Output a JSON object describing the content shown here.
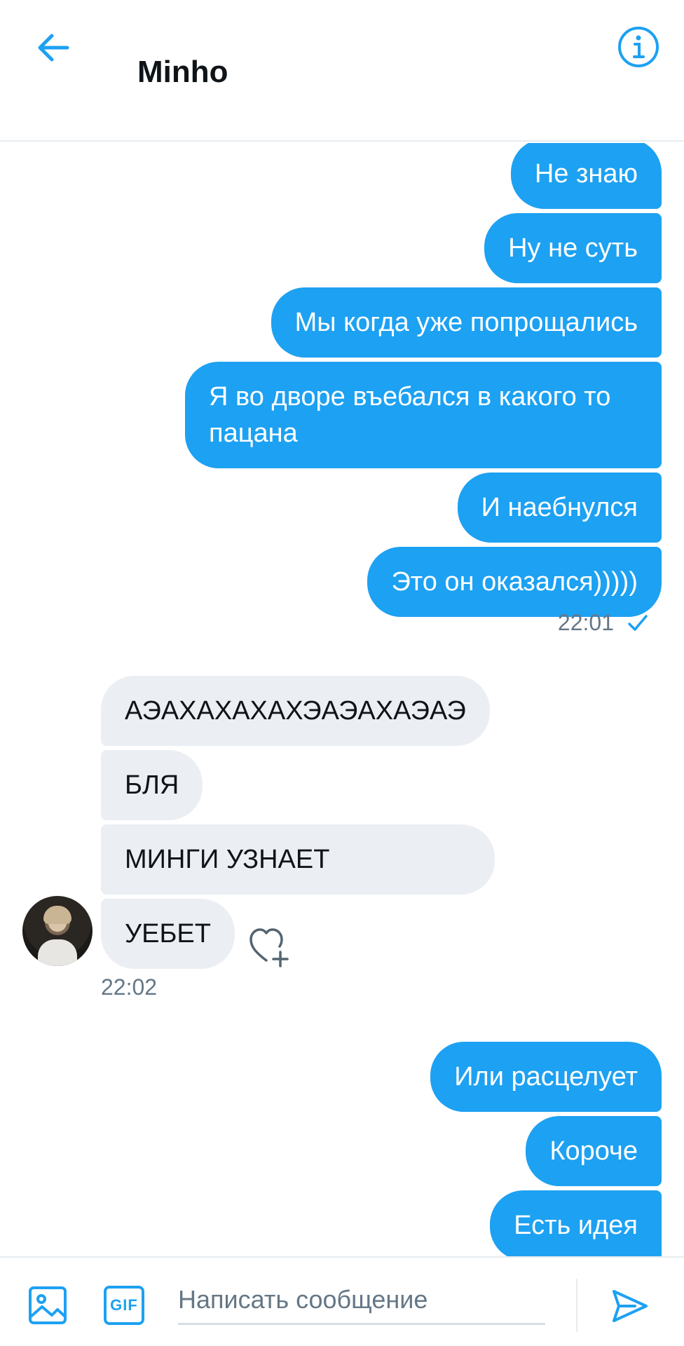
{
  "header": {
    "title": "Minho",
    "back_icon": "arrow-left-icon",
    "info_icon": "info-icon"
  },
  "colors": {
    "accent": "#1da1f2",
    "incoming_bubble": "#ebeef3",
    "muted_text": "#657786"
  },
  "messages": {
    "group1": [
      "Не знаю",
      "Ну не суть",
      "Мы когда уже попрощались",
      "Я во дворе въебался в какого то пацана",
      "И наебнулся",
      "Это он оказался)))))"
    ],
    "group1_time": "22:01",
    "group2": [
      "АЭАХАХАХАХЭАЭАХАЭАЭ",
      "БЛЯ",
      "МИНГИ УЗНАЕТ",
      "УЕБЕТ"
    ],
    "group2_time": "22:02",
    "group3": [
      "Или расцелует",
      "Короче",
      "Есть идея"
    ]
  },
  "composer": {
    "placeholder": "Написать сообщение",
    "gif_label": "GIF",
    "media_icon": "image-icon",
    "send_icon": "send-icon"
  }
}
